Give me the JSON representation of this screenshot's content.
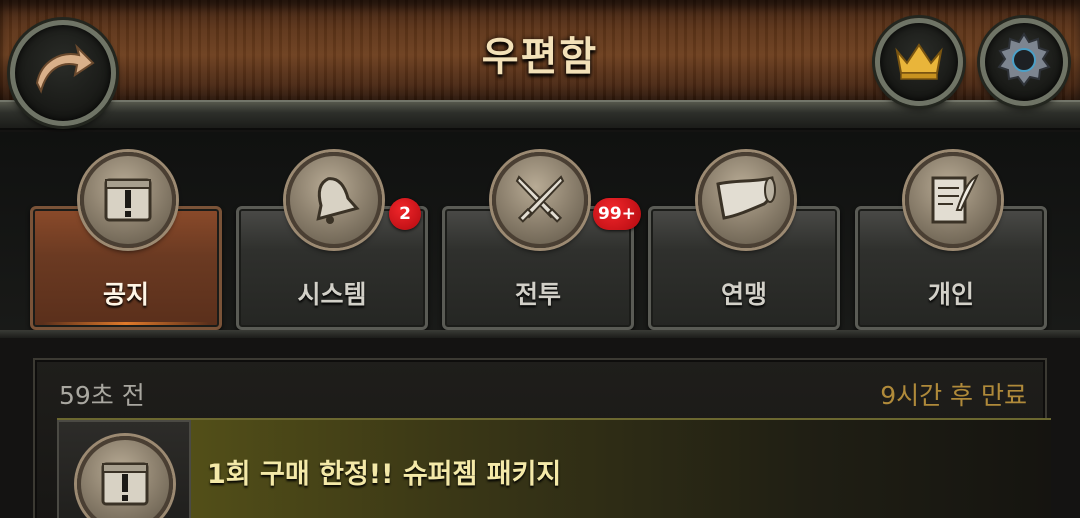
{
  "header": {
    "title": "우편함",
    "back_icon": "back-arrow-icon",
    "crown_icon": "crown-icon",
    "settings_icon": "gear-icon"
  },
  "tabs": [
    {
      "label": "공지",
      "icon": "notice-chest-icon",
      "active": true,
      "badge": ""
    },
    {
      "label": "시스템",
      "icon": "bell-icon",
      "active": false,
      "badge": "2"
    },
    {
      "label": "전투",
      "icon": "crossed-swords-icon",
      "active": false,
      "badge": "99+"
    },
    {
      "label": "연맹",
      "icon": "horn-icon",
      "active": false,
      "badge": ""
    },
    {
      "label": "개인",
      "icon": "quill-letter-icon",
      "active": false,
      "badge": ""
    }
  ],
  "mail": {
    "time_ago": "59초 전",
    "expires": "9시간 후 만료",
    "subject": "1회 구매 한정!! 슈퍼젬 패키지",
    "icon": "notice-chest-icon"
  },
  "colors": {
    "title": "#f3e1b8",
    "badge": "#d0141a",
    "expire_text": "#b08a3a",
    "subject_text": "#f4e9a8",
    "active_tab": "#6b3a22"
  }
}
